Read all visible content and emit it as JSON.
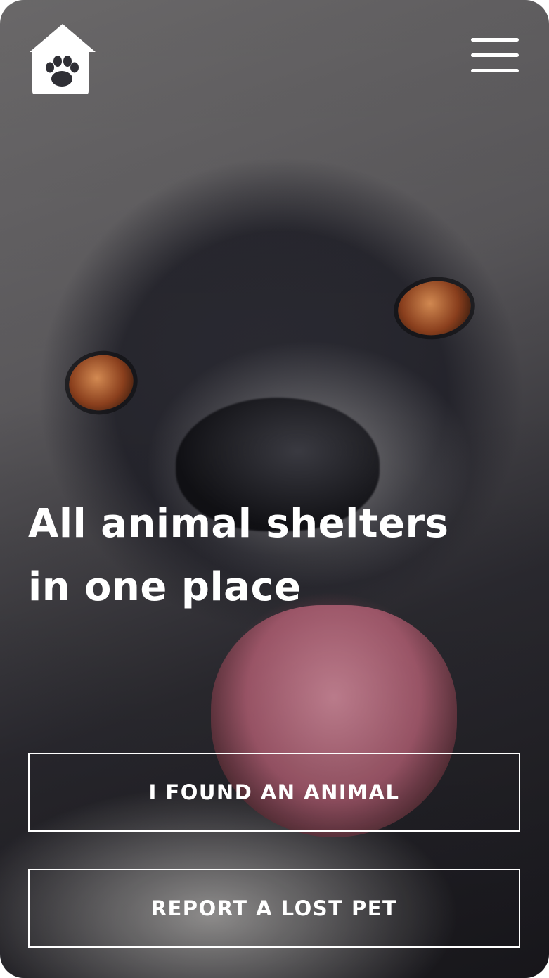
{
  "header": {
    "logo_icon": "house-paw-icon",
    "menu_icon": "hamburger-menu-icon"
  },
  "hero": {
    "headline_line1": "All animal shelters",
    "headline_line2": "in one place"
  },
  "actions": {
    "found_label": "I FOUND AN ANIMAL",
    "lost_label": "REPORT A LOST PET"
  },
  "colors": {
    "text": "#ffffff",
    "button_border": "#ffffff"
  }
}
